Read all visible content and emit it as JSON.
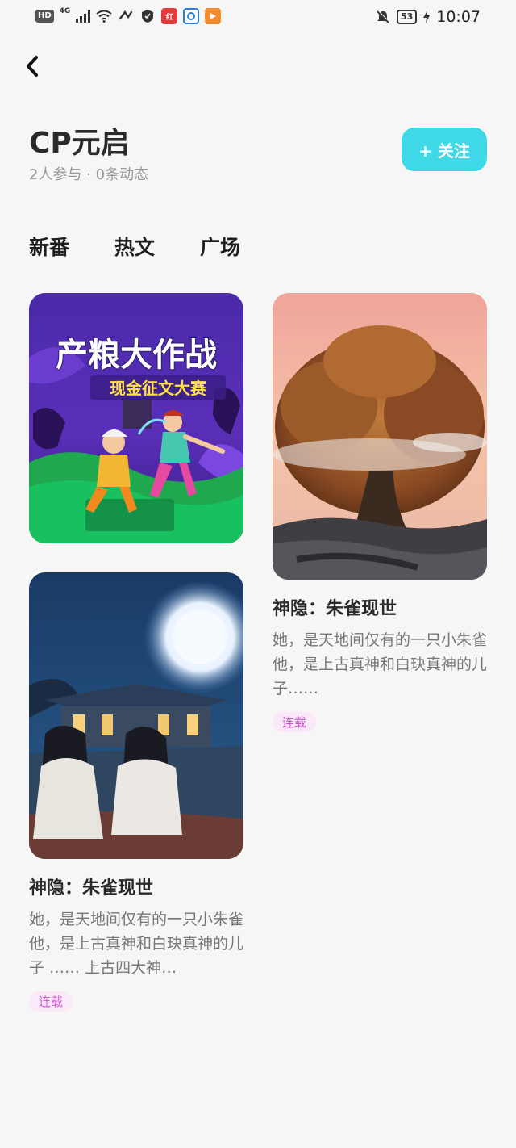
{
  "status_bar": {
    "hd": "HD",
    "network": "4G",
    "battery": "53",
    "time": "10:07",
    "icons": [
      "signal-icon",
      "wifi-icon",
      "nfc-icon",
      "shield-icon",
      "app-icon-red",
      "app-icon-blue",
      "app-icon-orange",
      "mute-icon",
      "charging-icon"
    ]
  },
  "header": {
    "title": "CP元启",
    "subtitle": "2人参与 · 0条动态",
    "follow_label": "+ 关注"
  },
  "tabs": [
    {
      "label": "新番",
      "active": false
    },
    {
      "label": "热文",
      "active": true
    },
    {
      "label": "广场",
      "active": false
    }
  ],
  "feed": {
    "banner": {
      "headline": "产粮大作战",
      "subline": "现金征文大赛"
    },
    "card_left": {
      "title": "神隐：朱雀现世",
      "desc": "她，是天地间仅有的一只小朱雀 他，是上古真神和白玦真神的儿子 …… 上古四大神…",
      "tag": "连载"
    },
    "card_right": {
      "title": "神隐：朱雀现世",
      "desc": "她，是天地间仅有的一只小朱雀他，是上古真神和白玦真神的儿子……",
      "tag": "连载"
    }
  },
  "colors": {
    "accent": "#3fd8e6",
    "tag_bg": "#fbe8f8",
    "tag_text": "#d05ad0"
  }
}
